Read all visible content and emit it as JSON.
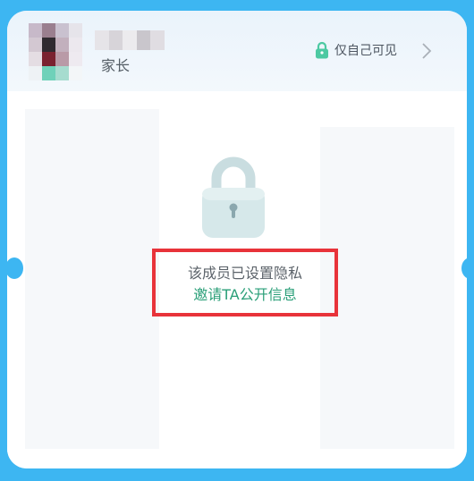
{
  "member": {
    "role": "家长"
  },
  "privacy": {
    "label": "仅自己可见",
    "icon": "lock-icon"
  },
  "notice": {
    "message": "该成员已设置隐私",
    "invite_link": "邀请TA公开信息"
  },
  "colors": {
    "background": "#3db6f2",
    "accent_green": "#2a9f78",
    "highlight_border": "#e8333a"
  }
}
